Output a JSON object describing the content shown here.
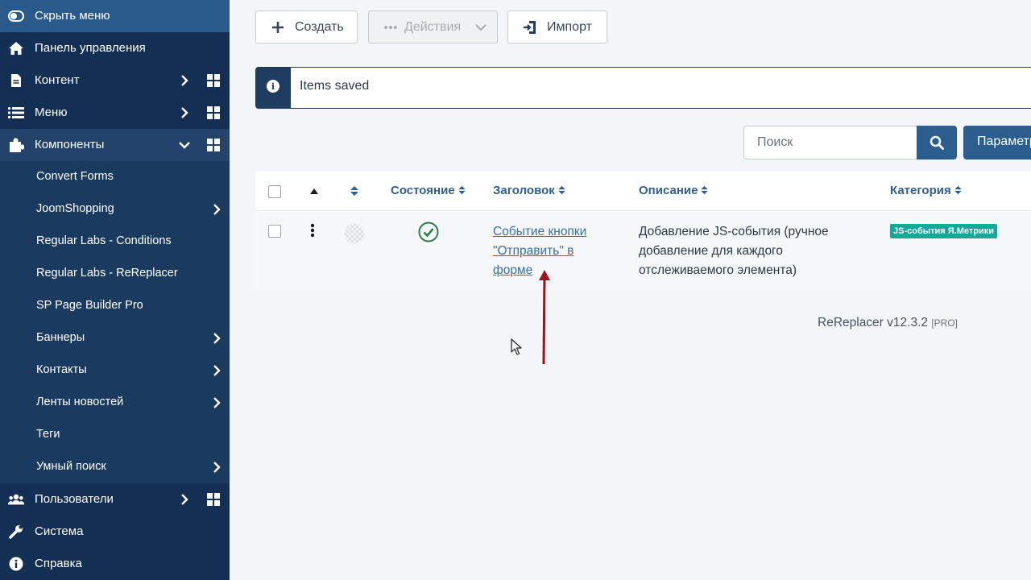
{
  "sidebar": {
    "hide_menu": "Скрыть меню",
    "items": [
      {
        "label": "Панель управления"
      },
      {
        "label": "Контент"
      },
      {
        "label": "Меню"
      },
      {
        "label": "Компоненты"
      },
      {
        "label": "Convert Forms"
      },
      {
        "label": "JoomShopping"
      },
      {
        "label": "Regular Labs - Conditions"
      },
      {
        "label": "Regular Labs - ReReplacer"
      },
      {
        "label": "SP Page Builder Pro"
      },
      {
        "label": "Баннеры"
      },
      {
        "label": "Контакты"
      },
      {
        "label": "Ленты новостей"
      },
      {
        "label": "Теги"
      },
      {
        "label": "Умный поиск"
      },
      {
        "label": "Пользователи"
      },
      {
        "label": "Система"
      },
      {
        "label": "Справка"
      }
    ]
  },
  "toolbar": {
    "create_label": "Создать",
    "actions_label": "Действия",
    "import_label": "Импорт"
  },
  "message": {
    "text": "Items saved"
  },
  "search": {
    "placeholder": "Поиск",
    "options_label": "Параметры"
  },
  "table": {
    "columns": [
      "Состояние",
      "Заголовок",
      "Описание",
      "Категория"
    ],
    "rows": [
      {
        "title": "Событие кнопки \"Отправить\" в форме",
        "description": "Добавление JS-события (ручное добавление для каждого отслеживаемого элемента)",
        "category": "JS-события Я.Метрики",
        "state": "published"
      }
    ]
  },
  "footer": {
    "version": "ReReplacer v12.3.2",
    "edition": "[PRO]"
  },
  "colors": {
    "sidebar": "#132f53",
    "accent": "#2b5e8e",
    "link": "#3a6ea5",
    "badge": "#12a89a",
    "annotation_arrow": "#a3101b"
  }
}
